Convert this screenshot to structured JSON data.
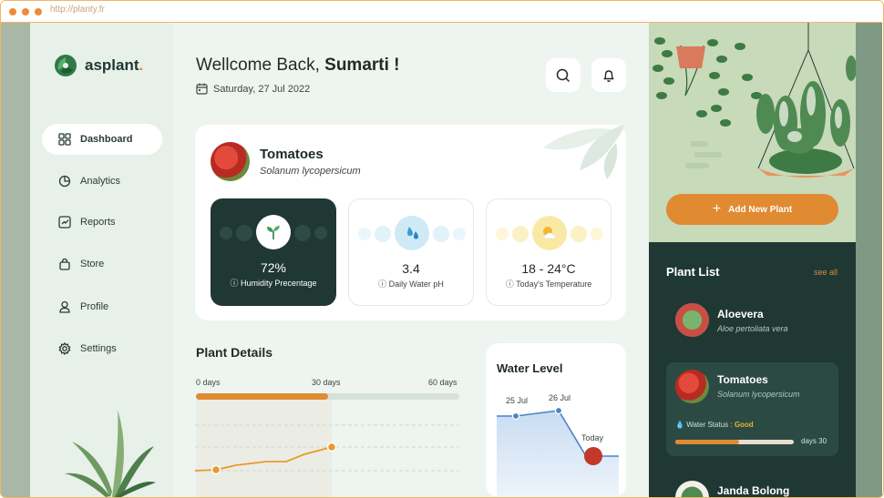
{
  "browser": {
    "url": "http://planty.fr"
  },
  "brand": {
    "name": "asplant",
    "dot": "."
  },
  "nav": [
    {
      "label": "Dashboard",
      "icon": "grid-icon",
      "active": true
    },
    {
      "label": "Analytics",
      "icon": "pie-chart-icon"
    },
    {
      "label": "Reports",
      "icon": "trend-chart-icon"
    },
    {
      "label": "Store",
      "icon": "shopping-bag-icon"
    },
    {
      "label": "Profile",
      "icon": "user-icon"
    },
    {
      "label": "Settings",
      "icon": "gear-icon"
    }
  ],
  "header": {
    "greeting": "Wellcome Back, ",
    "user": "Sumarti !",
    "date": "Saturday, 27 Jul 2022"
  },
  "plant_card": {
    "name": "Tomatoes",
    "scientific": "Solanum lycopersicum",
    "stats": [
      {
        "value": "72%",
        "label": "Humidity Precentage",
        "icon": "sprout-icon"
      },
      {
        "value": "3.4",
        "label": "Daily Water pH",
        "icon": "water-drops-icon"
      },
      {
        "value": "18 - 24°C",
        "label": "Today's Temperature",
        "icon": "sun-cloud-icon"
      }
    ]
  },
  "plant_details": {
    "title": "Plant Details",
    "day_labels": [
      "0 days",
      "30 days",
      "60 days"
    ],
    "progress": 0.5
  },
  "water_level": {
    "title": "Water Level",
    "labels": [
      "25 Jul",
      "26 Jul",
      "Today"
    ]
  },
  "right_panel": {
    "add_button": "Add New Plant",
    "list_title": "Plant List",
    "see_all": "see all",
    "plants": [
      {
        "name": "Aloevera",
        "scientific": "Aloe pertoliata vera"
      },
      {
        "name": "Tomatoes",
        "scientific": "Solanum lycopersicum",
        "status_label": "Water Status : ",
        "status_value": "Good",
        "days": "days 30",
        "progress": 0.54
      },
      {
        "name": "Janda Bolong",
        "scientific": ""
      }
    ]
  },
  "colors": {
    "accent": "#e08a32",
    "dark": "#1f3833",
    "mint": "#e8f0ea"
  }
}
